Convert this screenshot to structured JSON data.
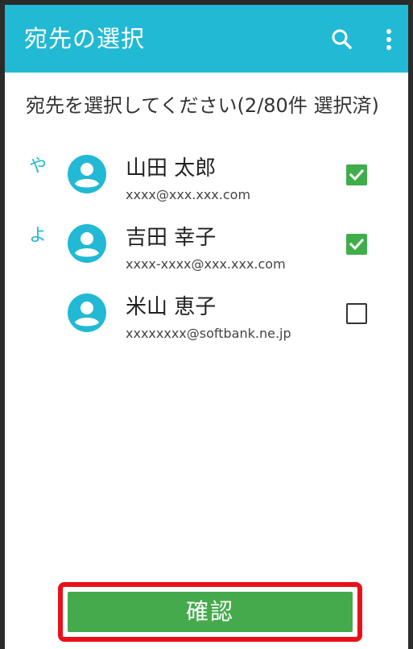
{
  "appbar": {
    "title": "宛先の選択",
    "icons": [
      "search-icon",
      "more-vert-icon"
    ],
    "color": "#22b9d4"
  },
  "instruction": "宛先を選択してください(2/80件 選択済)",
  "contacts": [
    {
      "index": "や",
      "name": "山田 太郎",
      "email": "xxxx@xxx.xxx.com",
      "checked": true
    },
    {
      "index": "よ",
      "name": "吉田 幸子",
      "email": "xxxx-xxxx@xxx.xxx.com",
      "checked": true
    },
    {
      "index": "",
      "name": "米山 恵子",
      "email": "xxxxxxxx@softbank.ne.jp",
      "checked": false
    }
  ],
  "confirm_button": {
    "label": "確認",
    "color": "#45aa4b",
    "highlight_color": "#e8111a"
  },
  "colors": {
    "check": "#3fae4a",
    "avatar": "#22b9d4"
  }
}
